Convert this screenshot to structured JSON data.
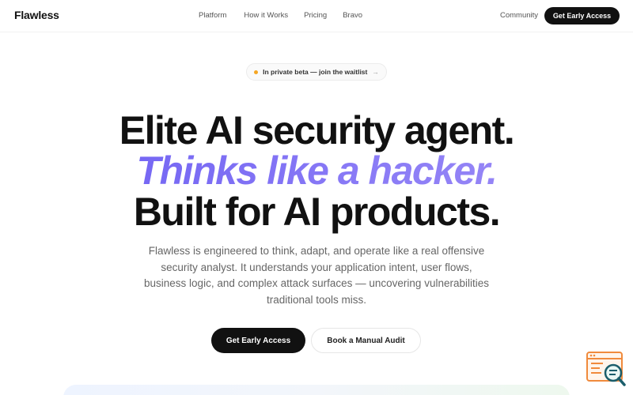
{
  "nav": {
    "brand": "Flawless",
    "links": [
      "Platform",
      "How it Works",
      "Pricing",
      "Bravo"
    ],
    "community": "Community",
    "cta": "Get Early Access"
  },
  "announcement": {
    "text": "In private beta — join the waitlist",
    "arrow": "→",
    "dot_color": "#f5a623"
  },
  "hero": {
    "line1": "Elite AI security agent.",
    "line2": "Thinks like a hacker.",
    "line3": "Built for AI products.",
    "accent_color": "#7b6ff0",
    "subtitle": "Flawless is engineered to think, adapt, and operate like a real offensive security analyst. It understands your application intent, user flows, business logic, and complex attack surfaces — uncovering vulnerabilities traditional tools miss."
  },
  "actions": {
    "primary": "Get Early Access",
    "secondary": "Book a Manual Audit"
  },
  "widget": {
    "icon": "code-search-icon"
  }
}
